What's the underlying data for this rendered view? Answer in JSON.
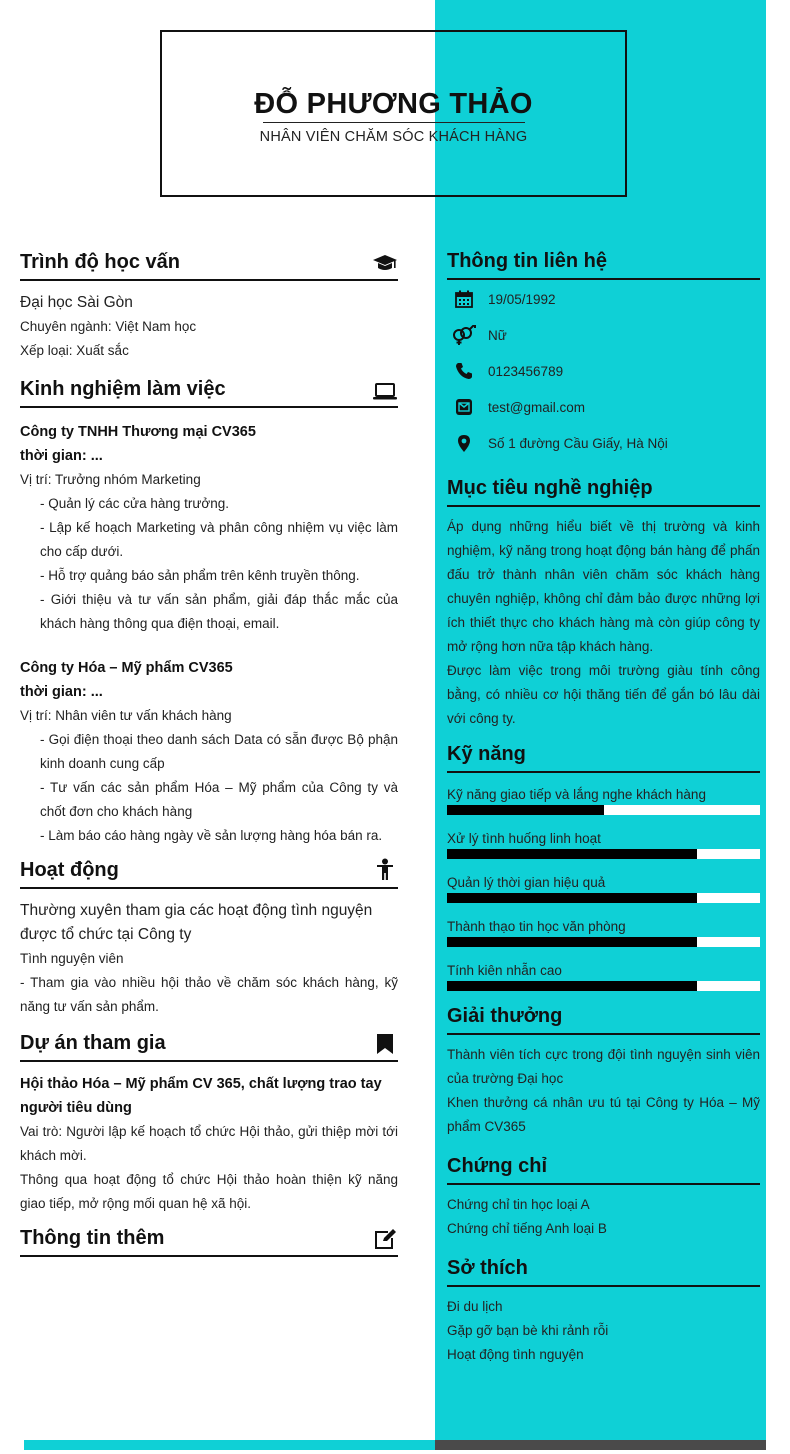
{
  "header": {
    "name": "ĐỖ PHƯƠNG THẢO",
    "job_title": "NHÂN VIÊN CHĂM SÓC KHÁCH HÀNG"
  },
  "education": {
    "title": "Trình độ học vấn",
    "icon": "graduation-cap-icon",
    "school": "Đại học Sài Gòn",
    "major": "Chuyên ngành: Việt Nam học",
    "rank": "Xếp loại: Xuất sắc"
  },
  "experience": {
    "title": "Kinh nghiệm làm việc",
    "icon": "laptop-icon",
    "jobs": [
      {
        "company": "Công ty TNHH Thương mại CV365",
        "time": "thời gian: ...",
        "position": "Vị trí: Trưởng nhóm Marketing",
        "tasks": [
          "- Quản lý các cửa hàng trưởng.",
          "- Lập kế hoạch Marketing và phân công nhiệm vụ việc làm cho cấp dưới.",
          "- Hỗ trợ quảng báo sản phẩm trên kênh truyền thông.",
          "- Giới thiệu và tư vấn sản phẩm, giải đáp thắc mắc của khách hàng thông qua điện thoại, email."
        ]
      },
      {
        "company": "Công ty Hóa – Mỹ phẩm CV365",
        "time": "thời gian: ...",
        "position": "Vị trí: Nhân viên tư vấn khách hàng",
        "tasks": [
          "- Gọi điện thoại theo danh sách Data có sẵn được Bộ phận kinh doanh cung cấp",
          "- Tư vấn các sản phẩm Hóa – Mỹ phẩm của Công ty và chốt đơn cho khách hàng",
          "- Làm báo cáo hàng ngày về sản lượng hàng hóa bán ra."
        ]
      }
    ]
  },
  "activities": {
    "title": "Hoạt động",
    "icon": "person-icon",
    "name": "Thường xuyên tham gia các hoạt động tình nguyện được tổ chức tại Công ty",
    "role": "Tình nguyện viên",
    "desc": "- Tham gia vào nhiều hội thảo về chăm sóc khách hàng, kỹ năng tư vấn sản phẩm."
  },
  "projects": {
    "title": "Dự án tham gia",
    "icon": "bookmark-icon",
    "name": "Hội thảo Hóa – Mỹ phẩm CV 365, chất lượng trao tay người tiêu dùng",
    "role": "Vai trò: Người lập kế hoạch tổ chức Hội thảo, gửi thiệp mời tới khách mời.",
    "desc": "Thông qua hoạt động tổ chức Hội thảo hoàn thiện kỹ năng giao tiếp, mở rộng mối quan hệ xã hội."
  },
  "more_info": {
    "title": "Thông tin thêm",
    "icon": "edit-icon"
  },
  "contact": {
    "title": "Thông tin liên hệ",
    "items": [
      {
        "icon": "calendar-icon",
        "value": "19/05/1992"
      },
      {
        "icon": "gender-icon",
        "value": "Nữ"
      },
      {
        "icon": "phone-icon",
        "value": "0123456789"
      },
      {
        "icon": "email-icon",
        "value": "test@gmail.com"
      },
      {
        "icon": "location-icon",
        "value": "Số 1 đường Cầu Giấy, Hà Nội"
      }
    ]
  },
  "objective": {
    "title": "Mục tiêu nghề nghiệp",
    "text": "Áp dụng những hiểu biết về thị trường và kinh nghiệm, kỹ năng trong hoạt động bán hàng để phấn đấu trở thành nhân viên chăm sóc khách hàng chuyên nghiệp, không chỉ đảm bảo được những lợi ích thiết thực cho khách hàng mà còn giúp công ty mở rộng hơn nữa tập khách hàng.",
    "text2": "Được làm việc trong môi trường giàu tính công bằng, có nhiều cơ hội thăng tiến để gắn bó lâu dài với công ty."
  },
  "skills": {
    "title": "Kỹ năng",
    "items": [
      {
        "name": "Kỹ năng giao tiếp và lắng nghe khách hàng",
        "level": 0.5
      },
      {
        "name": "Xử lý tình huống linh hoạt",
        "level": 0.8
      },
      {
        "name": "Quản lý thời gian hiệu quả",
        "level": 0.8
      },
      {
        "name": "Thành thạo tin học văn phòng",
        "level": 0.8
      },
      {
        "name": "Tính kiên nhẫn cao",
        "level": 0.8
      }
    ]
  },
  "awards": {
    "title": "Giải thưởng",
    "items": [
      "Thành viên tích cực trong đội tình nguyện sinh viên của trường Đại học",
      "Khen thưởng cá nhân ưu tú tại Công ty Hóa – Mỹ phẩm CV365"
    ]
  },
  "certificates": {
    "title": "Chứng chỉ",
    "items": [
      "Chứng chỉ tin học loại A",
      "Chứng chỉ tiếng Anh loại B"
    ]
  },
  "hobbies": {
    "title": "Sở thích",
    "items": [
      "Đi du lịch",
      "Gặp gỡ bạn bè khi rảnh rỗi",
      "Hoạt động tình nguyện"
    ]
  }
}
